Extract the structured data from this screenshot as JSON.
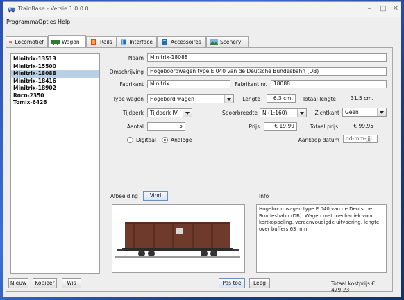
{
  "window": {
    "title": "TrainBase - Versie 1.0.0.0",
    "minimize": "–",
    "maximize": "□",
    "close": "✕"
  },
  "menu": [
    "Programma",
    "Opties",
    "Help"
  ],
  "tabs": [
    {
      "label": "Locomotief",
      "icon": "locomotive-icon",
      "color": "#c0392b"
    },
    {
      "label": "Wagon",
      "icon": "wagon-icon",
      "color": "#2e7d32"
    },
    {
      "label": "Rails",
      "icon": "rails-icon",
      "color": "#d35400"
    },
    {
      "label": "Interface",
      "icon": "interface-icon",
      "color": "#1f6fb5"
    },
    {
      "label": "Accessoires",
      "icon": "accessories-icon",
      "color": "#1f6fb5"
    },
    {
      "label": "Scenery",
      "icon": "scenery-icon",
      "color": "#2e7d32"
    }
  ],
  "active_tab": "Wagon",
  "wagon_list": [
    "Minitrix-13513",
    "Minitrix-15500",
    "Minitrix-18088",
    "Minitrix-18416",
    "Minitrix-18902",
    "Roco-2350",
    "Tomix-6426"
  ],
  "selected_index": 2,
  "form": {
    "naam_label": "Naam",
    "naam": "Minitrix-18088",
    "omschrijving_label": "Omschrijving",
    "omschrijving": "Hogeboordwagen type E 040 van de Deutsche Bundesbahn (DB)",
    "fabrikant_label": "Fabrikant",
    "fabrikant": "Minitrix",
    "fabrikantnr_label": "Fabrikant nr.",
    "fabrikantnr": "18088",
    "type_label": "Type wagon",
    "type": "Hogebord wagen",
    "lengte_label": "Lengte",
    "lengte": "6.3 cm.",
    "totaal_lengte_label": "Totaal lengte",
    "totaal_lengte": "31.5 cm.",
    "tijdperk_label": "Tijdperk",
    "tijdperk": "Tijdperk IV",
    "spoorbreedte_label": "Spoorbreedte",
    "spoorbreedte": "N (1:160)",
    "zichtkant_label": "Zichtkant",
    "zichtkant": "Geen",
    "aantal_label": "Aantal",
    "aantal": "5",
    "prijs_label": "Prijs",
    "prijs": "€ 19.99",
    "totaal_prijs_label": "Totaal prijs",
    "totaal_prijs": "€ 99.95",
    "aankoop_label": "Aankoop datum",
    "aankoop_placeholder": "dd-mm-jjjj",
    "digitaal_label": "Digitaal",
    "analoge_label": "Analoge",
    "analoge_selected": true
  },
  "image_section": {
    "label": "Afbeelding",
    "button": "Vind"
  },
  "info_section": {
    "label": "Info",
    "text": "Hogeboordwagen type E 040 van de Deutsche Bundesbahn (DB). Wagen met mechaniek voor kortkoppeling, vereenvoudigde uitvoering, lengte over buffers 63 mm."
  },
  "buttons": {
    "nieuw": "Nieuw",
    "kopieer": "Kopieer",
    "wis": "Wis",
    "pas_toe": "Pas toe",
    "leeg": "Leeg"
  },
  "total_cost": "Totaal kostprijs € 479.23"
}
